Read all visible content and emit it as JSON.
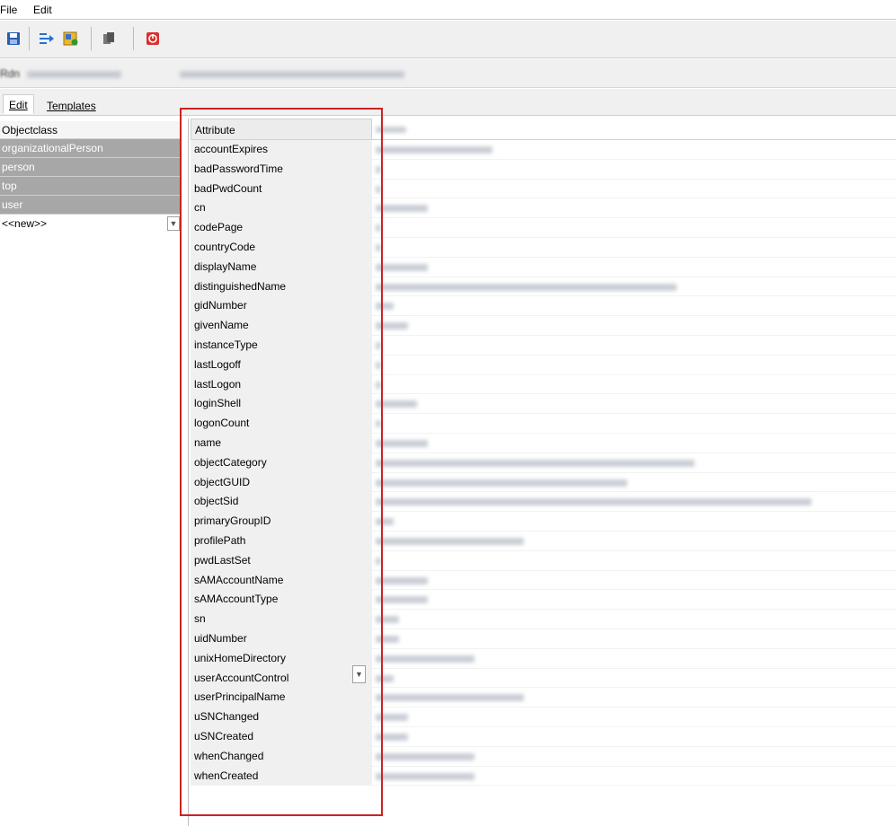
{
  "menu": {
    "file": "File",
    "edit": "Edit"
  },
  "toolbar": {
    "icons": [
      "save-icon",
      "import-icon",
      "edit-entry-icon",
      "copy-icon",
      "stop-icon"
    ],
    "colors": {
      "save": "#2a5db0",
      "import": "#2a6fd0",
      "edit": "#d9a020",
      "copy": "#666666",
      "stop": "#d93030"
    }
  },
  "dn": {
    "label": "Rdn",
    "rdn_value": "",
    "dn_value": ""
  },
  "tabs": [
    {
      "label": "Edit"
    },
    {
      "label": "Templates"
    }
  ],
  "objectclass": {
    "header": "Objectclass",
    "items": [
      "organizationalPerson",
      "person",
      "top",
      "user"
    ],
    "new_item": "<<new>>"
  },
  "attributes": {
    "header": "Attribute",
    "value_header": "",
    "items": [
      "accountExpires",
      "badPasswordTime",
      "badPwdCount",
      "cn",
      "codePage",
      "countryCode",
      "displayName",
      "distinguishedName",
      "gidNumber",
      "givenName",
      "instanceType",
      "lastLogoff",
      "lastLogon",
      "loginShell",
      "logonCount",
      "name",
      "objectCategory",
      "objectGUID",
      "objectSid",
      "primaryGroupID",
      "profilePath",
      "pwdLastSet",
      "sAMAccountName",
      "sAMAccountType",
      "sn",
      "uidNumber",
      "unixHomeDirectory",
      "userAccountControl",
      "userPrincipalName",
      "uSNChanged",
      "uSNCreated",
      "whenChanged",
      "whenCreated"
    ]
  },
  "colors": {
    "highlight": "#cc2222",
    "selected_row": "#a7a7a7"
  }
}
